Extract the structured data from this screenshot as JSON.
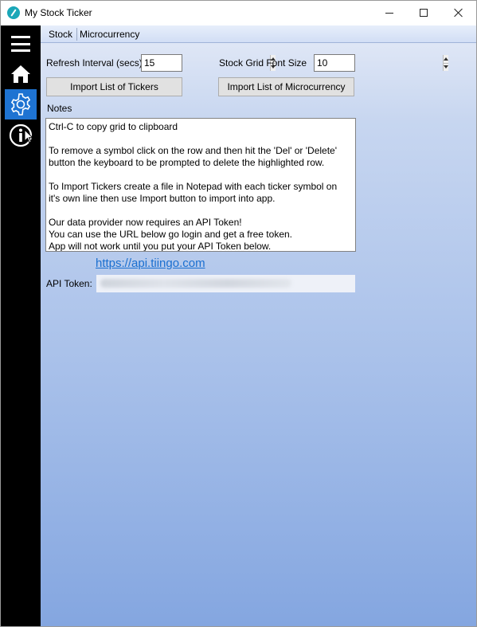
{
  "window": {
    "title": "My Stock Ticker",
    "controls": {
      "minimize": "minimize-icon",
      "maximize": "maximize-icon",
      "close": "close-icon"
    }
  },
  "sidebar": {
    "items": [
      {
        "name": "menu",
        "icon": "hamburger-icon"
      },
      {
        "name": "home",
        "icon": "home-icon"
      },
      {
        "name": "settings",
        "icon": "gear-icon",
        "selected": true
      },
      {
        "name": "info",
        "icon": "info-icon"
      }
    ],
    "selected_color": "#1e73d2"
  },
  "tabs": [
    {
      "label": "Stock"
    },
    {
      "label": "Microcurrency"
    }
  ],
  "settings": {
    "refresh_label": "Refresh Interval (secs)",
    "refresh_value": "15",
    "font_size_label": "Stock Grid Font Size",
    "font_size_value": "10",
    "import_tickers_label": "Import List of Tickers",
    "import_micro_label": "Import List of Microcurrency",
    "notes_label": "Notes",
    "notes_lines": [
      "Ctrl-C to copy grid to clipboard",
      "",
      "To remove a symbol click on the row and then hit the 'Del' or 'Delete'",
      "button the keyboard to be prompted to delete the highlighted row.",
      "",
      "To Import Tickers create a file in Notepad with each ticker symbol on",
      "it's own line then use Import button to import into app.",
      "",
      "Our data provider now requires an API Token!",
      "You can use the URL below go login and get a free token.",
      "App will not work until you put your API Token below."
    ],
    "link_text": "https://api.tiingo.com",
    "token_label": "API Token:"
  }
}
